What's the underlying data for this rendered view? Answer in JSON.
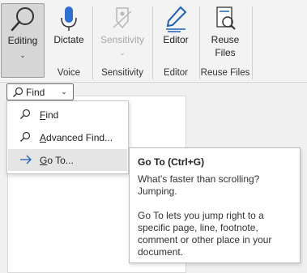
{
  "ribbon": {
    "editing_label": "Editing",
    "dictate_label": "Dictate",
    "sensitivity_label": "Sensitivity",
    "editor_label": "Editor",
    "reuse_files_line1": "Reuse",
    "reuse_files_line2": "Files",
    "groups": {
      "voice": "Voice",
      "sensitivity": "Sensitivity",
      "editor": "Editor",
      "reuse_files": "Reuse Files"
    }
  },
  "find_button": {
    "label": "Find"
  },
  "menu": {
    "items": [
      {
        "icon": "search-icon",
        "accel": "F",
        "rest": "ind"
      },
      {
        "icon": "search-icon",
        "accel": "A",
        "rest": "dvanced Find..."
      },
      {
        "icon": "arrow-right-icon",
        "accel": "G",
        "rest": "o To..."
      }
    ]
  },
  "tooltip": {
    "title": "Go To (Ctrl+G)",
    "line1": "What's faster than scrolling? Jumping.",
    "line2": "Go To lets you jump right to a specific page, line, footnote, comment or other place in your document."
  },
  "colors": {
    "accent": "#2b579a",
    "icon_blue": "#1e5fb4",
    "hover": "#e5e5e5"
  }
}
